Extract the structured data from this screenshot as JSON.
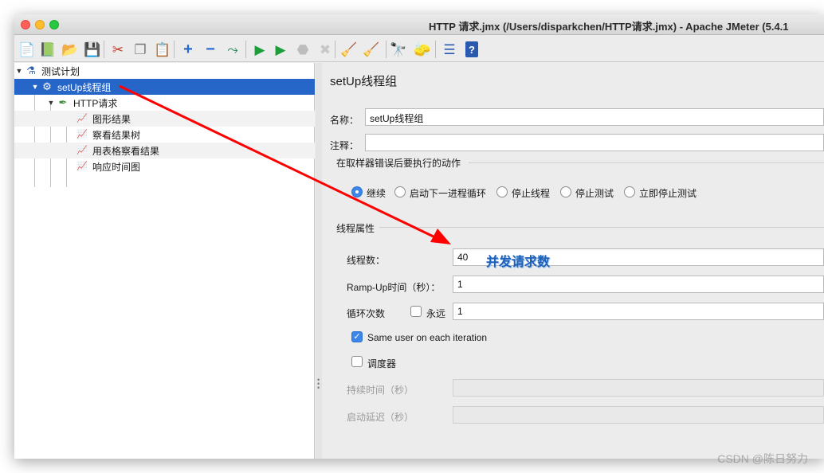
{
  "window": {
    "title": "HTTP 请求.jmx (/Users/disparkchen/HTTP请求.jmx) - Apache JMeter (5.4.1"
  },
  "toolbar": {
    "buttons": [
      {
        "name": "new",
        "icon": "new-file-icon",
        "glyph": "📄"
      },
      {
        "name": "templates",
        "icon": "templates-icon",
        "glyph": "📗"
      },
      {
        "name": "open",
        "icon": "open-folder-icon",
        "glyph": "📂"
      },
      {
        "name": "save",
        "icon": "save-icon",
        "glyph": "💾"
      },
      {
        "name": "cut",
        "icon": "cut-icon",
        "glyph": "✂"
      },
      {
        "name": "copy",
        "icon": "copy-icon",
        "glyph": "❐"
      },
      {
        "name": "paste",
        "icon": "paste-icon",
        "glyph": "📋"
      },
      {
        "name": "expand",
        "icon": "plus-icon",
        "glyph": "+"
      },
      {
        "name": "collapse",
        "icon": "minus-icon",
        "glyph": "−"
      },
      {
        "name": "toggle",
        "icon": "toggle-icon",
        "glyph": "⤳"
      },
      {
        "name": "start",
        "icon": "play-icon",
        "glyph": "▶"
      },
      {
        "name": "start-no-pause",
        "icon": "play-no-pause-icon",
        "glyph": "▶"
      },
      {
        "name": "stop",
        "icon": "stop-icon",
        "glyph": "⬣"
      },
      {
        "name": "shutdown",
        "icon": "shutdown-icon",
        "glyph": "✖"
      },
      {
        "name": "clear",
        "icon": "broom-icon",
        "glyph": "🧹"
      },
      {
        "name": "clear-all",
        "icon": "clear-all-icon",
        "glyph": "🧹"
      },
      {
        "name": "search",
        "icon": "binoculars-icon",
        "glyph": "🔭"
      },
      {
        "name": "reset-search",
        "icon": "reset-search-icon",
        "glyph": "🧽"
      },
      {
        "name": "function-helper",
        "icon": "list-icon",
        "glyph": "☰"
      },
      {
        "name": "help",
        "icon": "help-icon",
        "glyph": "?"
      }
    ]
  },
  "tree": {
    "items": [
      {
        "label": "测试计划",
        "icon": "test-plan-icon",
        "glyph": "⚗"
      },
      {
        "label": "setUp线程组",
        "icon": "gear-icon",
        "glyph": "⚙"
      },
      {
        "label": "HTTP请求",
        "icon": "pipette-icon",
        "glyph": "✒"
      },
      {
        "label": "图形结果",
        "icon": "graph-icon",
        "glyph": "📈"
      },
      {
        "label": "察看结果树",
        "icon": "graph-icon",
        "glyph": "📈"
      },
      {
        "label": "用表格察看结果",
        "icon": "graph-icon",
        "glyph": "📈"
      },
      {
        "label": "响应时间图",
        "icon": "graph-icon",
        "glyph": "📈"
      }
    ]
  },
  "panel": {
    "title": "setUp线程组",
    "name_label": "名称：",
    "name_value": "setUp线程组",
    "comment_label": "注释：",
    "comment_value": "",
    "error_group_title": "在取样器错误后要执行的动作",
    "error_actions": [
      {
        "label": "继续",
        "selected": true
      },
      {
        "label": "启动下一进程循环",
        "selected": false
      },
      {
        "label": "停止线程",
        "selected": false
      },
      {
        "label": "停止测试",
        "selected": false
      },
      {
        "label": "立即停止测试",
        "selected": false
      }
    ],
    "thread_group_title": "线程属性",
    "threads_label": "线程数：",
    "threads_value": "40",
    "rampup_label": "Ramp-Up时间（秒）：",
    "rampup_value": "1",
    "loop_label": "循环次数",
    "forever_label": "永远",
    "forever_checked": false,
    "loop_value": "1",
    "same_user_label": "Same user on each iteration",
    "same_user_checked": true,
    "scheduler_label": "调度器",
    "scheduler_checked": false,
    "duration_label": "持续时间（秒）",
    "duration_value": "",
    "delay_label": "启动延迟（秒）",
    "delay_value": ""
  },
  "annotation": {
    "text": "并发请求数",
    "arrow_color": "#ff0000"
  },
  "watermark": "CSDN @陈日努力"
}
